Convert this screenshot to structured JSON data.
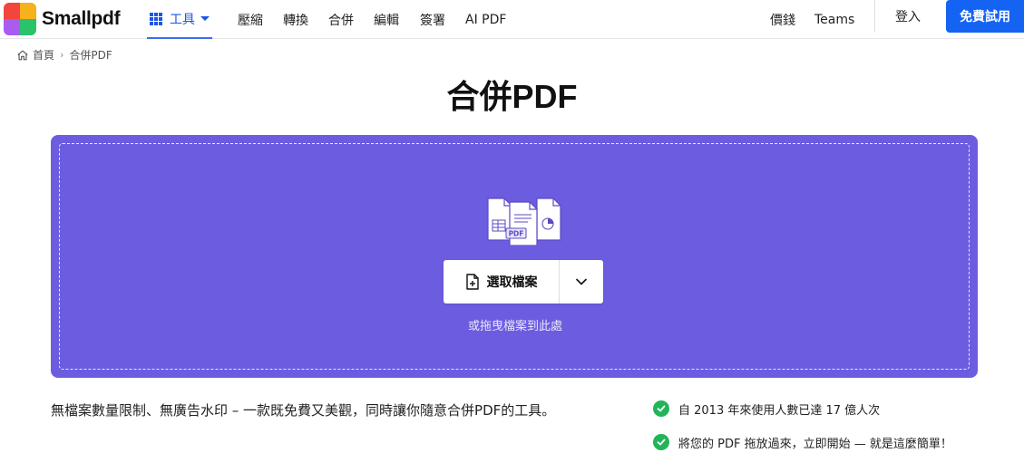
{
  "header": {
    "logo_text": "Smallpdf",
    "tools_label": "工具",
    "nav": [
      "壓縮",
      "轉換",
      "合併",
      "編輯",
      "簽署",
      "AI PDF"
    ],
    "pricing_label": "價錢",
    "teams_label": "Teams",
    "login_label": "登入",
    "cta_label": "免費試用"
  },
  "breadcrumb": {
    "home_label": "首頁",
    "current_label": "合併PDF"
  },
  "page_title": "合併PDF",
  "dropzone": {
    "illustration_label": "PDF",
    "choose_label": "選取檔案",
    "drop_hint": "或拖曳檔案到此處",
    "background_color": "#6c5ce0"
  },
  "description": "無檔案數量限制、無廣告水印 – 一款既免費又美觀，同時讓你隨意合併PDF的工具。",
  "features": [
    "自 2013 年來使用人數已達 17 億人次",
    "將您的 PDF 拖放過來，立即開始 — 就是這麼簡單！"
  ],
  "colors": {
    "accent": "#1463f3",
    "check": "#23b45a"
  }
}
